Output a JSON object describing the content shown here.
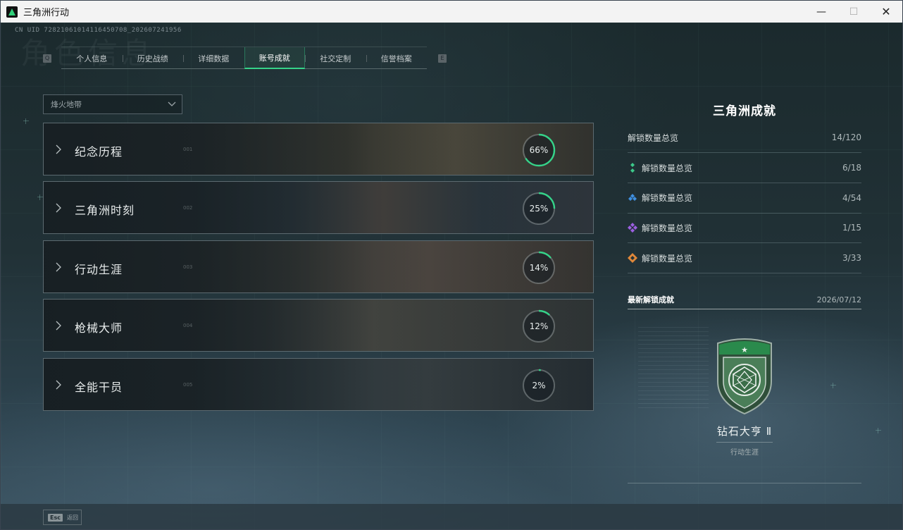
{
  "window": {
    "title": "三角洲行动",
    "minimize": "—",
    "maximize": "☐",
    "close": "✕"
  },
  "uid": "CN UID 72821061014116450708_202607241956",
  "ghost_title": "角色信息",
  "tab_keys": {
    "left": "Q",
    "right": "E"
  },
  "tabs": [
    {
      "label": "个人信息",
      "active": false
    },
    {
      "label": "历史战绩",
      "active": false
    },
    {
      "label": "详细数据",
      "active": false
    },
    {
      "label": "账号成就",
      "active": true
    },
    {
      "label": "社交定制",
      "active": false
    },
    {
      "label": "信誉档案",
      "active": false
    }
  ],
  "mode_select": {
    "value": "烽火地带"
  },
  "categories": [
    {
      "label": "纪念历程",
      "index": "001",
      "progress_text": "66%",
      "progress": 0.66
    },
    {
      "label": "三角洲时刻",
      "index": "002",
      "progress_text": "25%",
      "progress": 0.25
    },
    {
      "label": "行动生涯",
      "index": "003",
      "progress_text": "14%",
      "progress": 0.14
    },
    {
      "label": "枪械大师",
      "index": "004",
      "progress_text": "12%",
      "progress": 0.12
    },
    {
      "label": "全能干员",
      "index": "005",
      "progress_text": "2%",
      "progress": 0.02
    }
  ],
  "summary": {
    "title": "三角洲成就",
    "total": {
      "label": "解锁数量总览",
      "value": "14/120"
    },
    "tiers": [
      {
        "label": "解锁数量总览",
        "value": "6/18",
        "icon": "green-gem-icon",
        "color": "#3cc98a"
      },
      {
        "label": "解锁数量总览",
        "value": "4/54",
        "icon": "blue-gem-icon",
        "color": "#3f8fe0"
      },
      {
        "label": "解锁数量总览",
        "value": "1/15",
        "icon": "purple-gem-icon",
        "color": "#9b5fe0"
      },
      {
        "label": "解锁数量总览",
        "value": "3/33",
        "icon": "orange-gem-icon",
        "color": "#e0883a"
      }
    ]
  },
  "latest": {
    "heading": "最新解锁成就",
    "date": "2026/07/12",
    "name": "钻石大亨 Ⅱ",
    "category": "行动生涯"
  },
  "footer": {
    "esc_key": "Esc",
    "esc_label": "返回"
  },
  "colors": {
    "accent": "#35d389",
    "progress_ring": "#35d389"
  }
}
